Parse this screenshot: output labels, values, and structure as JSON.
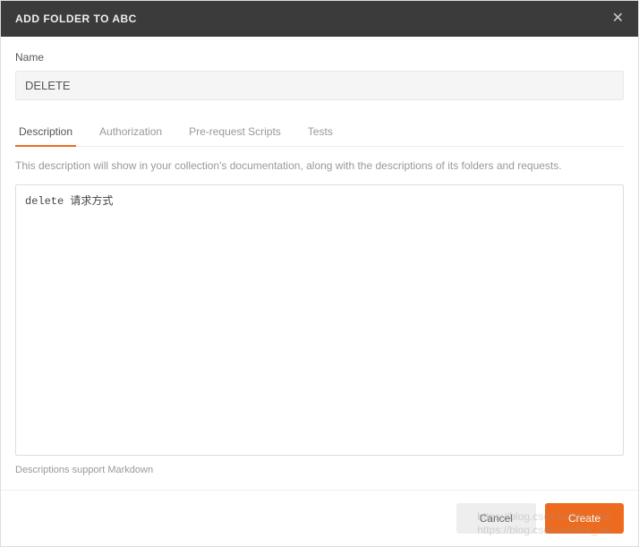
{
  "header": {
    "title": "ADD FOLDER TO ABC"
  },
  "form": {
    "name_label": "Name",
    "name_value": "DELETE"
  },
  "tabs": {
    "description": "Description",
    "authorization": "Authorization",
    "prerequest": "Pre-request Scripts",
    "tests": "Tests"
  },
  "description_panel": {
    "hint": "This description will show in your collection's documentation, along with the descriptions of its folders and requests.",
    "textarea_value": "delete 请求方式",
    "markdown_hint": "Descriptions support Markdown"
  },
  "footer": {
    "cancel": "Cancel",
    "create": "Create"
  },
  "watermark": {
    "line1": "https://blog.csdn.net/fen_fen",
    "line2": "https://blog.csdn.net/fen_fen"
  }
}
